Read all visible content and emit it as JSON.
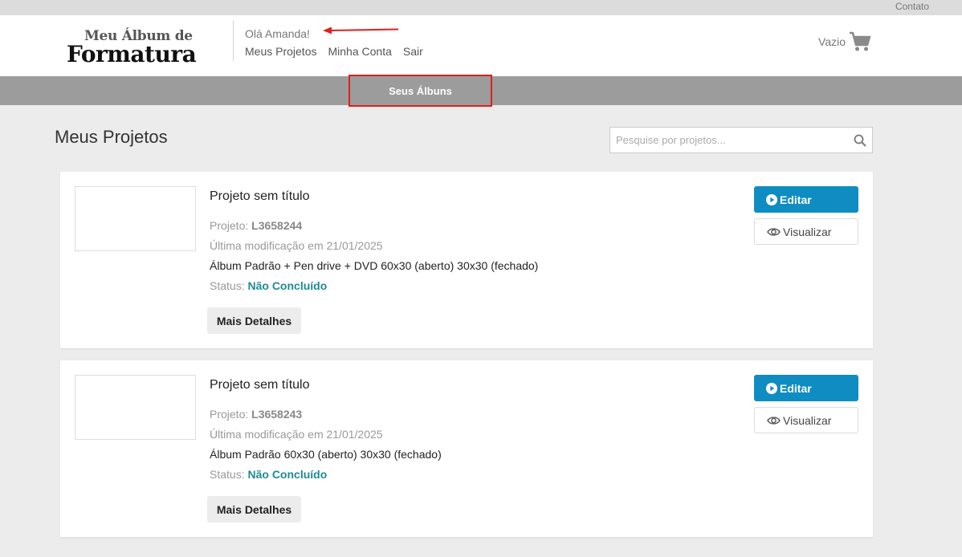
{
  "topbar": {
    "contact": "Contato"
  },
  "header": {
    "logo_line1": "Meu Álbum de",
    "logo_line2": "Formatura",
    "greeting": "Olá Amanda!",
    "nav": [
      "Meus Projetos",
      "Minha Conta",
      "Sair"
    ],
    "cart_label": "Vazio"
  },
  "navbar": {
    "item": "Seus Álbuns"
  },
  "page": {
    "title": "Meus Projetos",
    "search_placeholder": "Pesquise por projetos..."
  },
  "colors": {
    "edit_button": "#0f8dc2",
    "status_text": "#1e8b93",
    "annotation": "#e0201a",
    "navbar": "#9c9c9c"
  },
  "projects": [
    {
      "title": "Projeto sem título",
      "project_label": "Projeto:",
      "project_code": "L3658244",
      "modified": "Última modificação em 21/01/2025",
      "product": "Álbum Padrão + Pen drive + DVD 60x30 (aberto) 30x30 (fechado)",
      "status_label": "Status:",
      "status": "Não Concluído",
      "details_label": "Mais Detalhes",
      "edit_label": "Editar",
      "view_label": "Visualizar"
    },
    {
      "title": "Projeto sem título",
      "project_label": "Projeto:",
      "project_code": "L3658243",
      "modified": "Última modificação em 21/01/2025",
      "product": "Álbum Padrão 60x30 (aberto) 30x30 (fechado)",
      "status_label": "Status:",
      "status": "Não Concluído",
      "details_label": "Mais Detalhes",
      "edit_label": "Editar",
      "view_label": "Visualizar"
    }
  ]
}
